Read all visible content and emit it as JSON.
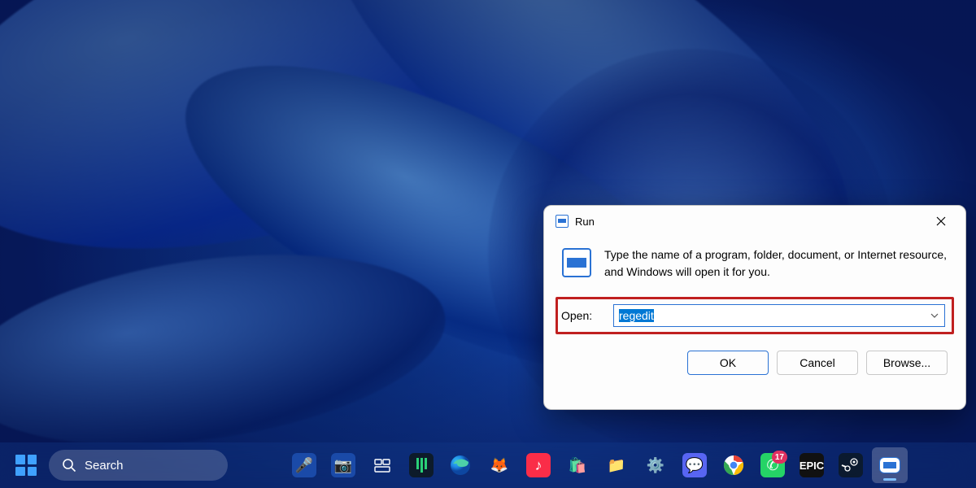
{
  "run_dialog": {
    "title": "Run",
    "description": "Type the name of a program, folder, document, or Internet resource, and Windows will open it for you.",
    "open_label": "Open:",
    "input_value": "regedit",
    "buttons": {
      "ok": "OK",
      "cancel": "Cancel",
      "browse": "Browse..."
    }
  },
  "taskbar": {
    "search_placeholder": "Search",
    "whatsapp_badge": "17",
    "apps": [
      {
        "name": "microphone",
        "bg": "#1a4aa8",
        "glyph": "🎤"
      },
      {
        "name": "camera",
        "bg": "#1a4aa8",
        "glyph": "📷"
      },
      {
        "name": "task-view",
        "bg": "transparent",
        "glyph": "⧉"
      },
      {
        "name": "dashlane",
        "bg": "#0d1b2a",
        "glyph": "▮▮▮"
      },
      {
        "name": "edge",
        "bg": "transparent",
        "glyph": "🌐"
      },
      {
        "name": "firefox",
        "bg": "transparent",
        "glyph": "🦊"
      },
      {
        "name": "apple-music",
        "bg": "#fa2d48",
        "glyph": "♪"
      },
      {
        "name": "microsoft-store",
        "bg": "transparent",
        "glyph": "🛍️"
      },
      {
        "name": "file-explorer",
        "bg": "transparent",
        "glyph": "📁"
      },
      {
        "name": "settings",
        "bg": "transparent",
        "glyph": "⚙️"
      },
      {
        "name": "discord",
        "bg": "#5865f2",
        "glyph": "💬"
      },
      {
        "name": "chrome",
        "bg": "transparent",
        "glyph": "🟢"
      },
      {
        "name": "whatsapp",
        "bg": "#25d366",
        "glyph": "✆"
      },
      {
        "name": "epic-games",
        "bg": "#111",
        "glyph": "E"
      },
      {
        "name": "steam",
        "bg": "#0b1a2f",
        "glyph": "◯"
      },
      {
        "name": "run",
        "bg": "#ffffff",
        "glyph": "▭"
      }
    ]
  }
}
